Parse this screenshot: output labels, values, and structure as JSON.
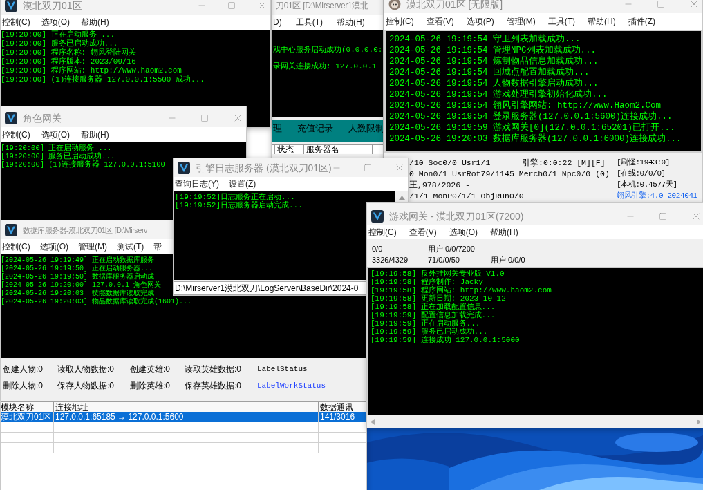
{
  "center_window": {
    "title": "刀01区  [D:\\Mirserver1漠北",
    "menus": [
      "D)",
      "工具(T)",
      "帮助(H)"
    ],
    "log": [
      "戏中心服务启动成功(0.0.0.0:",
      "录网关连接成功: 127.0.0.1"
    ],
    "tabs": [
      "理",
      "充值记录",
      "人数限制"
    ],
    "columns": [
      "状态",
      "服务器名"
    ]
  },
  "login_gateway": {
    "title": "漠北双刀01区",
    "menus": [
      "控制(C)",
      "选项(O)",
      "帮助(H)"
    ],
    "log": [
      "[19:20:00] 正在启动服务 ...",
      "[19:20:00] 服务已启动成功...",
      "[19:20:00] 程序名称: 翎风登陆网关",
      "[19:20:00] 程序版本: 2023/09/16",
      "[19:20:00] 程序网站: http://www.haom2.com",
      "[19:20:00] (1)连接服务器 127.0.0.1:5500 成功..."
    ]
  },
  "engine": {
    "title": "漠北双刀01区 [无限版]",
    "menus": [
      "控制(C)",
      "查看(V)",
      "选项(P)",
      "管理(M)",
      "工具(T)",
      "帮助(H)",
      "插件(Z)"
    ],
    "log": [
      "2024-05-26 19:19:54 守卫列表加载成功...",
      "2024-05-26 19:19:54 管理NPC列表加载成功...",
      "2024-05-26 19:19:54 炼制物品信息加载成功...",
      "2024-05-26 19:19:54 回城点配置加载成功...",
      "2024-05-26 19:19:54 人物数据引擎启动成功...",
      "2024-05-26 19:19:54 游戏处理引擎初始化成功...",
      "2024-05-26 19:19:54 翎风引擎网站: http://www.Haom2.Com",
      "2024-05-26 19:19:54 登录服务器(127.0.0.1:5600)连接成功...",
      "2024-05-26 19:19:59 游戏网关[0](127.0.0.1:65201)已打开...",
      "2024-05-26 19:20:03 数据库服务器(127.0.0.1:6000)连接成功..."
    ],
    "status_left": [
      "/10 Soc0/0 Usr1/1",
      "0 Mon0/1 UsrRot79/1145 Merch0/1 Npc0/0 (0)",
      "王,978/2026 -",
      "/1/1 MonP0/1/1 ObjRun0/0"
    ],
    "engine_timer": "引擎:0:0:22 [M][F]",
    "status_right": [
      {
        "text": "[刷怪:1943:0]",
        "kind": "plain"
      },
      {
        "text": "[在线:0/0/0]",
        "kind": "plain"
      },
      {
        "text": "[本机:0.4577天]",
        "kind": "plain"
      },
      {
        "text": "翎风引擎:4.0 2024041",
        "kind": "version"
      }
    ]
  },
  "role_gateway": {
    "title": "角色网关",
    "menus": [
      "控制(C)",
      "选项(O)",
      "帮助(H)"
    ],
    "log": [
      "[19:20:00] 正在启动服务 ...",
      "[19:20:00] 服务已启动成功...",
      "[19:20:00] (1)连接服务器 127.0.0.1:5100"
    ]
  },
  "db_server": {
    "title": "数据库服务器-漠北双刀01区  [D:\\Mirserv",
    "menus": [
      "控制(C)",
      "选项(O)",
      "管理(M)",
      "测试(T)",
      "帮"
    ],
    "log": [
      "[2024-05-26 19:19:49] 正在启动数据库服务",
      "[2024-05-26 19:19:50] 正在启动服务器...",
      "[2024-05-26 19:19:50] 数据库服务器启动成",
      "[2024-05-26 19:20:00] 127.0.0.1 角色网关",
      "[2024-05-26 19:20:03] 技能数据库读取完成",
      "[2024-05-26 19:20:03] 物品数据库读取完成(1601)..."
    ],
    "counters": [
      [
        "创建人物:0",
        "读取人物数据:0",
        "创建英雄:0",
        "读取英雄数据:0"
      ],
      [
        "删除人物:0",
        "保存人物数据:0",
        "删除英雄:0",
        "保存英雄数据:0"
      ]
    ],
    "status_labels": [
      {
        "text": "LabelStatus",
        "kind": "status"
      },
      {
        "text": "LabelWorkStatus",
        "kind": "work_status"
      }
    ],
    "table": {
      "columns": [
        "模块名称",
        "连接地址",
        "数据通讯"
      ],
      "rows": [
        {
          "cells": [
            "漠北双刀01区",
            "127.0.0.1:65185 → 127.0.0.1:5600",
            "141/3016"
          ],
          "selected": true
        }
      ]
    }
  },
  "log_server": {
    "title": "引擎日志服务器 (漠北双刀01区)",
    "menus": [
      "查询日志(Y)",
      "设置(Z)"
    ],
    "log": [
      "[19:19:52]日志服务正在启动...",
      "[19:19:52]日志服务器启动完成..."
    ],
    "path": "D:\\Mirserver1漠北双刀\\LogServer\\BaseDir\\2024-0"
  },
  "game_gateway": {
    "title": "游戏网关 - 漠北双刀01区(7200)",
    "menus": [
      "控制(C)",
      "查看(V)",
      "选项(O)",
      "帮助(H)"
    ],
    "stats": [
      [
        "0/0",
        "用户 0/0/7200"
      ],
      [
        "3326/4329",
        "71/0/0/50",
        "用户 0/0/0"
      ]
    ],
    "log": [
      "[19:19:58] 反外挂网关专业版 V1.0",
      "[19:19:58] 程序制作: Jacky",
      "[19:19:58] 程序网站: http://www.haom2.com",
      "[19:19:58] 更新日期: 2023-10-12",
      "[19:19:58] 正在加载配置信息...",
      "[19:19:59] 配置信息加载完成...",
      "[19:19:59] 正在启动服务...",
      "[19:19:59] 服务已启动成功...",
      "[19:19:59] 连接成功 127.0.0.1:5000"
    ]
  }
}
